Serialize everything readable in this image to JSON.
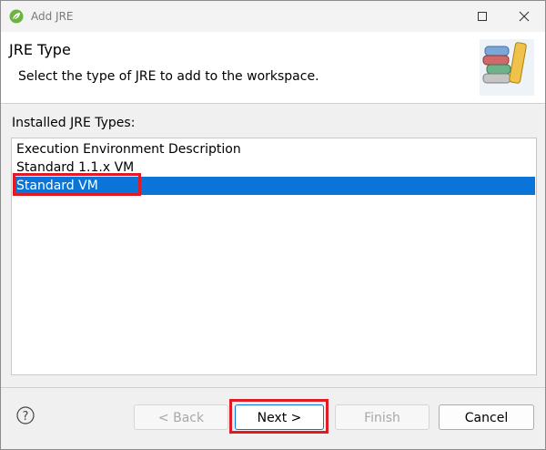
{
  "window": {
    "title": "Add JRE"
  },
  "header": {
    "title": "JRE Type",
    "description": "Select the type of JRE to add to the workspace."
  },
  "list": {
    "label": "Installed JRE Types:",
    "items": [
      {
        "label": "Execution Environment Description",
        "selected": false
      },
      {
        "label": "Standard 1.1.x VM",
        "selected": false
      },
      {
        "label": "Standard VM",
        "selected": true
      }
    ]
  },
  "buttons": {
    "back": "< Back",
    "next": "Next >",
    "finish": "Finish",
    "cancel": "Cancel"
  },
  "colors": {
    "selection": "#0a74d8",
    "annotation": "#e01b24"
  }
}
